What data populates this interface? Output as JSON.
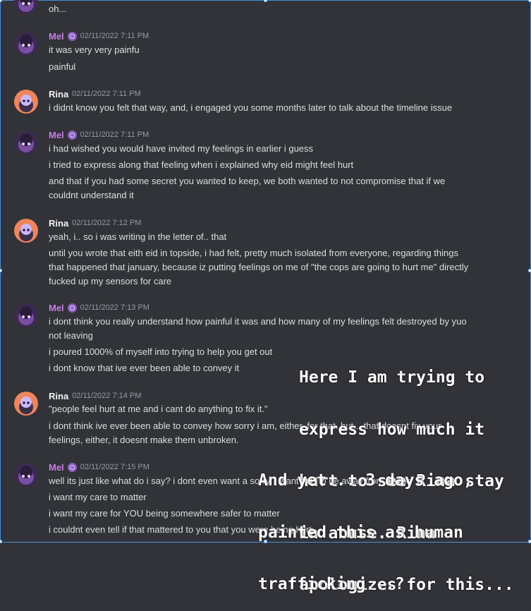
{
  "messages": [
    {
      "author": "",
      "timestamp": "",
      "lines": [
        "oh..."
      ]
    },
    {
      "author": "Mel",
      "timestamp": "02/11/2022 7:11 PM",
      "lines": [
        "it was very very painfu",
        "painful"
      ]
    },
    {
      "author": "Rina",
      "timestamp": "02/11/2022 7:11 PM",
      "lines": [
        "i didnt know you felt that way, and, i engaged you some months later to talk about the timeline issue"
      ]
    },
    {
      "author": "Mel",
      "timestamp": "02/11/2022 7:11 PM",
      "lines": [
        "i had wished you would have invited my feelings in earlier i guess",
        "i tried to express along that feeling when i explained why eid might feel hurt",
        "and that if you had some secret you wanted to keep, we both wanted to not compromise that if we",
        "couldnt understand it"
      ]
    },
    {
      "author": "Rina",
      "timestamp": "02/11/2022 7:12 PM",
      "lines": [
        "yeah, i.. so i was writing in the letter of.. that",
        "until you wrote that eith eid in topside, i had felt, pretty much isolated from everyone, regarding things",
        "that happened that january, because iz putting feelings on me of \"the cops are going to hurt me\" directly",
        "fucked up my sensors for care"
      ]
    },
    {
      "author": "Mel",
      "timestamp": "02/11/2022 7:13 PM",
      "lines": [
        "i dont think you really understand how painful it was and how many of my feelings felt destroyed by yuo",
        "not leaving",
        "i poured 1000% of myself into trying to help you get out",
        "i dont know that ive ever been able to convey it"
      ]
    },
    {
      "author": "Rina",
      "timestamp": "02/11/2022 7:14 PM",
      "lines": [
        "\"people feel hurt at me and i cant do anything to fix it.\"",
        "i dont think ive ever been able to convey how sorry i am, either, for that. but... that doesnt fix your",
        "feelings, either, it doesnt make them unbroken."
      ]
    },
    {
      "author": "Mel",
      "timestamp": "02/11/2022 7:15 PM",
      "lines": [
        "well its just like what do i say? i dont even want a sorry, i want you to be away from abuse",
        "i want my care to matter",
        "i want my care for YOU being somewhere safer to matter",
        "i couldnt even tell if that mattered to you that you were being hurt"
      ]
    }
  ],
  "overlays": {
    "first": [
      "Here I am trying to",
      "express how much it",
      "hurt to see Rina stay",
      "in abuse. Rina",
      "apologizes for this..."
    ],
    "second": [
      "And yet... 3 days ago,",
      "painted this as human",
      "trafficking...?"
    ]
  },
  "colors": {
    "background": "#313338",
    "mel_name": "#c87de6",
    "rina_name": "#f2f3f5",
    "text": "#dbdee1",
    "timestamp": "#949ba4",
    "selection_border": "#4a8fd8"
  },
  "icons": {
    "mel_avatar": "purple-character-avatar",
    "rina_avatar": "orange-character-avatar",
    "badge": "nitro-badge-icon"
  }
}
